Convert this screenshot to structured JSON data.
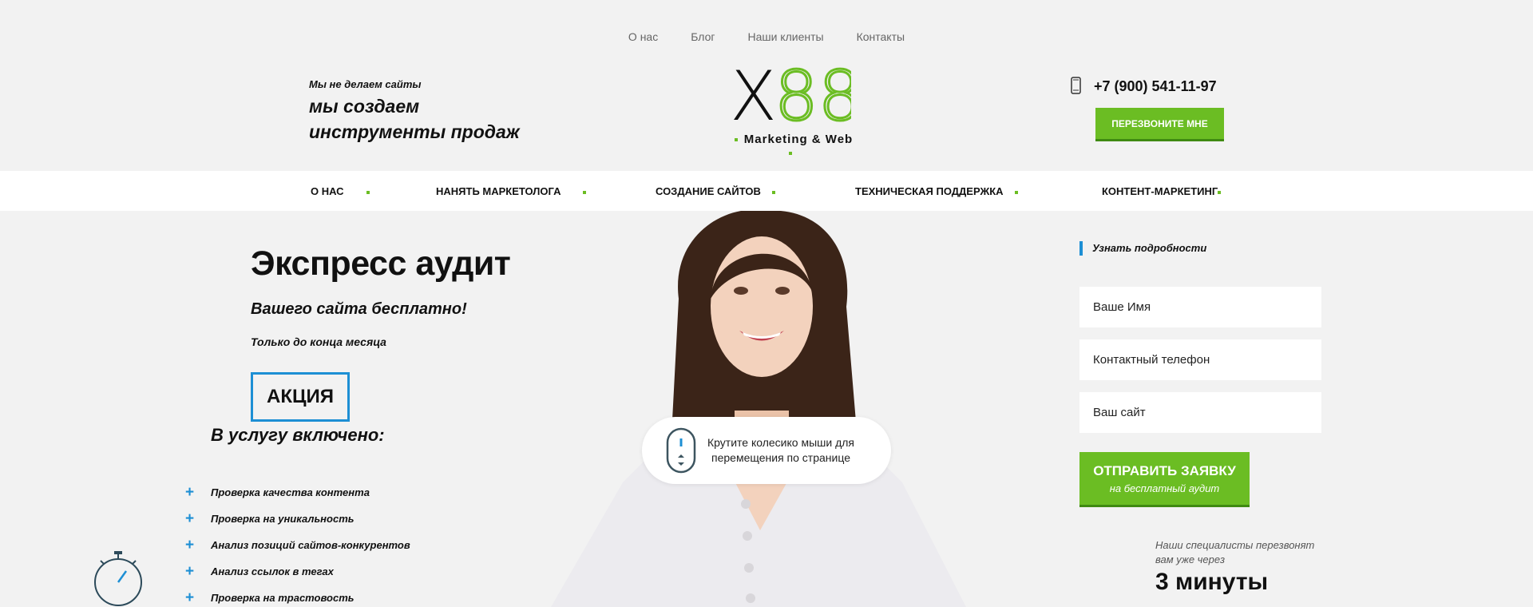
{
  "top_nav": [
    "О нас",
    "Блог",
    "Наши клиенты",
    "Контакты"
  ],
  "header": {
    "tagline_small": "Мы не делаем сайты",
    "tagline_line1": "мы создаем",
    "tagline_line2": "инструменты продаж",
    "logo_text_x": "X",
    "logo_text_88": "88",
    "logo_subtitle": "Marketing & Web",
    "phone": "+7 (900) 541-11-97",
    "callback_label": "ПЕРЕЗВОНИТЕ МНЕ"
  },
  "main_nav": [
    "О НАС",
    "НАНЯТЬ МАРКЕТОЛОГА",
    "СОЗДАНИЕ САЙТОВ",
    "ТЕХНИЧЕСКАЯ ПОДДЕРЖКА",
    "КОНТЕНТ-МАРКЕТИНГ"
  ],
  "promo": {
    "title": "Экспресс аудит",
    "subtitle": "Вашего сайта бесплатно!",
    "deadline": "Только до конца месяца",
    "badge": "АКЦИЯ",
    "included_title": "В услугу включено:",
    "items": [
      "Проверка качества контента",
      "Проверка на уникальность",
      "Анализ позиций сайтов-конкурентов",
      "Анализ ссылок в тегах",
      "Проверка на трастовость"
    ]
  },
  "scroll_hint": {
    "line1": "Крутите колесико мыши для",
    "line2": "перемещения по странице"
  },
  "form": {
    "title": "Узнать подробности",
    "name_placeholder": "Ваше Имя",
    "phone_placeholder": "Контактный телефон",
    "site_placeholder": "Ваш сайт",
    "submit_line1": "ОТПРАВИТЬ ЗАЯВКУ",
    "submit_line2": "на бесплатный аудит",
    "note_line1": "Наши специалисты перезвонят",
    "note_line2": "вам уже через",
    "minutes": "3 минуты"
  },
  "colors": {
    "accent_green": "#6bbd23",
    "accent_blue": "#1d8fd4",
    "background": "#f2f2f2"
  },
  "icons": [
    "phone-icon",
    "plus-icon",
    "stopwatch-icon",
    "mouse-scroll-icon"
  ]
}
